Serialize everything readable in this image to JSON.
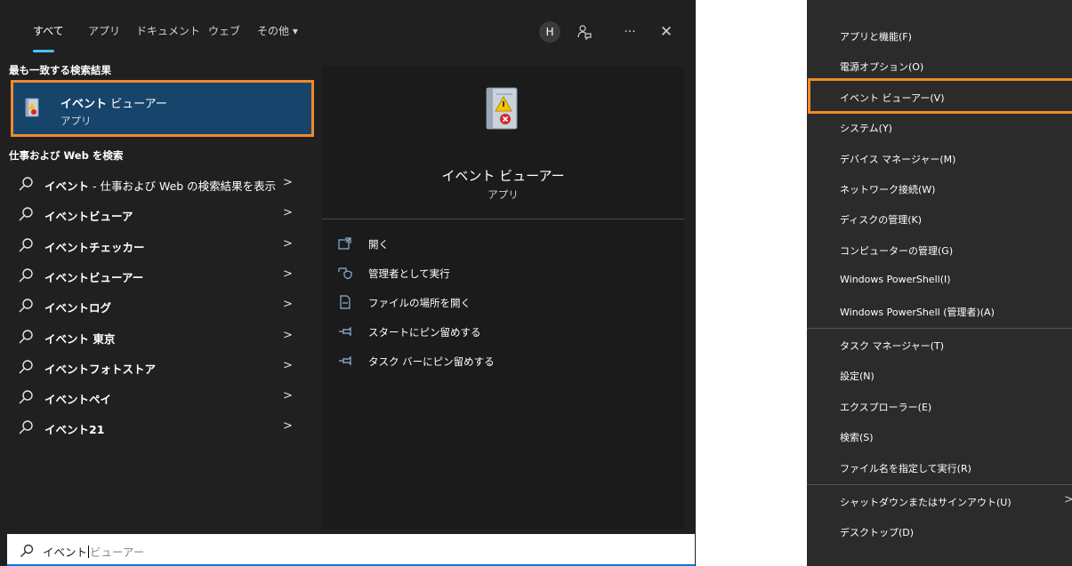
{
  "search": {
    "tabs": [
      "すべて",
      "アプリ",
      "ドキュメント",
      "ウェブ",
      "その他 ▾"
    ],
    "avatar_letter": "H",
    "icons": [
      "feedback-icon",
      "more-icon",
      "close-icon"
    ],
    "more_label": "···",
    "close_label": "✕",
    "best_match_header": "最も一致する検索結果",
    "best_match": {
      "title_bold": "イベント",
      "title_rest": " ビューアー",
      "subtitle": "アプリ"
    },
    "web_header": "仕事および Web を検索",
    "results": [
      {
        "bold": "イベント",
        "rest": " - 仕事および Web の検索結果を表示"
      },
      {
        "bold": "イベントビューア",
        "rest": ""
      },
      {
        "bold": "イベントチェッカー",
        "rest": ""
      },
      {
        "bold": "イベントビューアー",
        "rest": ""
      },
      {
        "bold": "イベントログ",
        "rest": ""
      },
      {
        "bold": "イベント 東京",
        "rest": ""
      },
      {
        "bold": "イベントフォトストア",
        "rest": ""
      },
      {
        "bold": "イベントペイ",
        "rest": ""
      },
      {
        "bold": "イベント21",
        "rest": ""
      }
    ],
    "chevron": ">",
    "preview": {
      "title": "イベント ビューアー",
      "subtitle": "アプリ",
      "actions": [
        "開く",
        "管理者として実行",
        "ファイルの場所を開く",
        "スタートにピン留めする",
        "タスク バーにピン留めする"
      ]
    },
    "searchbox": {
      "typed": "イベント",
      "ghost": "ビューアー"
    }
  },
  "winx_menu": {
    "items": [
      "アプリと機能(F)",
      "電源オプション(O)",
      "イベント ビューアー(V)",
      "システム(Y)",
      "デバイス マネージャー(M)",
      "ネットワーク接続(W)",
      "ディスクの管理(K)",
      "コンピューターの管理(G)",
      "Windows PowerShell(I)",
      "Windows PowerShell (管理者)(A)",
      "タスク マネージャー(T)",
      "設定(N)",
      "エクスプローラー(E)",
      "検索(S)",
      "ファイル名を指定して実行(R)",
      "シャットダウンまたはサインアウト(U)",
      "デスクトップ(D)"
    ],
    "submenu_arrow": ">"
  },
  "colors": {
    "accent": "#4cc2ff",
    "highlight": "#f08a2c",
    "selection": "#16446b"
  }
}
